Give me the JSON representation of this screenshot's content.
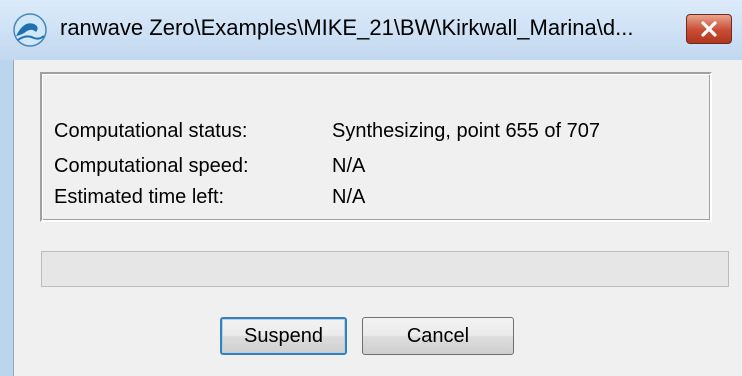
{
  "window": {
    "title": "ranwave Zero\\Examples\\MIKE_21\\BW\\Kirkwall_Marina\\d...",
    "app_icon": "wave-icon",
    "close_icon": "close-icon"
  },
  "status": {
    "rows": [
      {
        "label": "Computational status:",
        "value": "Synthesizing, point 655 of 707"
      },
      {
        "label": "Computational speed:",
        "value": "N/A"
      },
      {
        "label": "Estimated time left:",
        "value": "N/A"
      }
    ]
  },
  "progress": {
    "fraction": 0
  },
  "buttons": {
    "suspend_label": "Suspend",
    "cancel_label": "Cancel"
  }
}
